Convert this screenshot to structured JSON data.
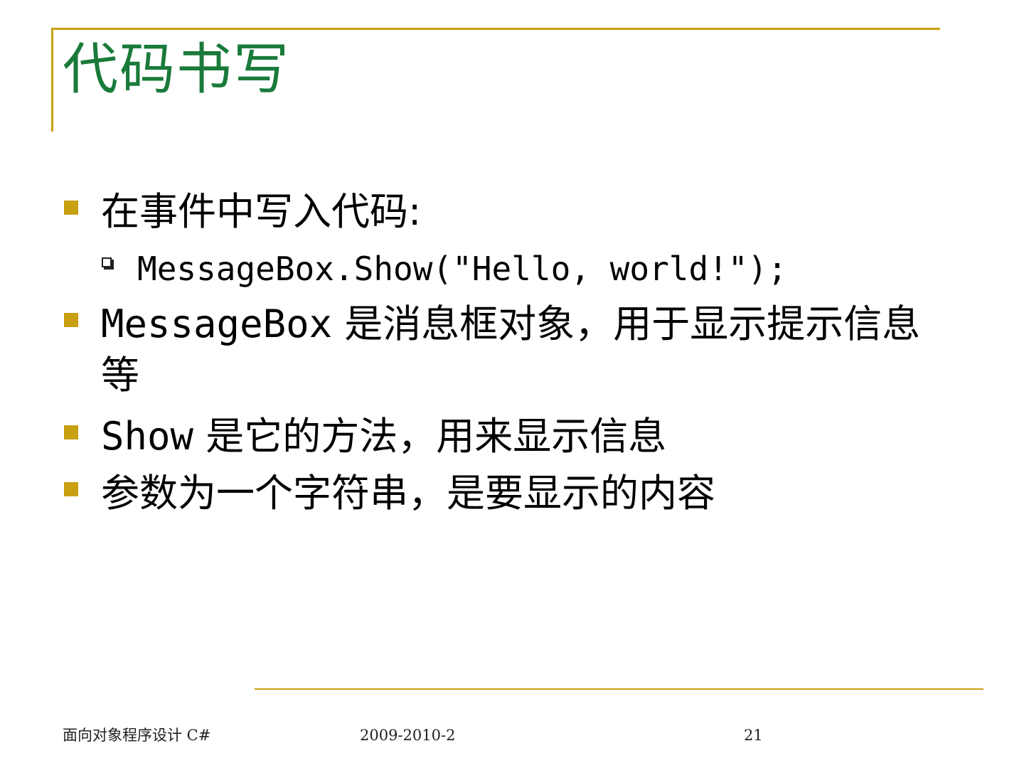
{
  "slide": {
    "title": "代码书写",
    "bullets": [
      {
        "prefix": "",
        "text": "在事件中写入代码:",
        "sub": [
          "MessageBox.Show(\"Hello, world!\");"
        ]
      },
      {
        "prefix": "MessageBox",
        "text": " 是消息框对象，用于显示提示信息等"
      },
      {
        "prefix": "Show",
        "text": " 是它的方法，用来显示信息"
      },
      {
        "prefix": "",
        "text": "参数为一个字符串，是要显示的内容"
      }
    ]
  },
  "footer": {
    "course": "面向对象程序设计 C#",
    "term": "2009-2010-2",
    "page": "21"
  },
  "colors": {
    "accent": "#c9a012",
    "title": "#1a7a3a"
  }
}
